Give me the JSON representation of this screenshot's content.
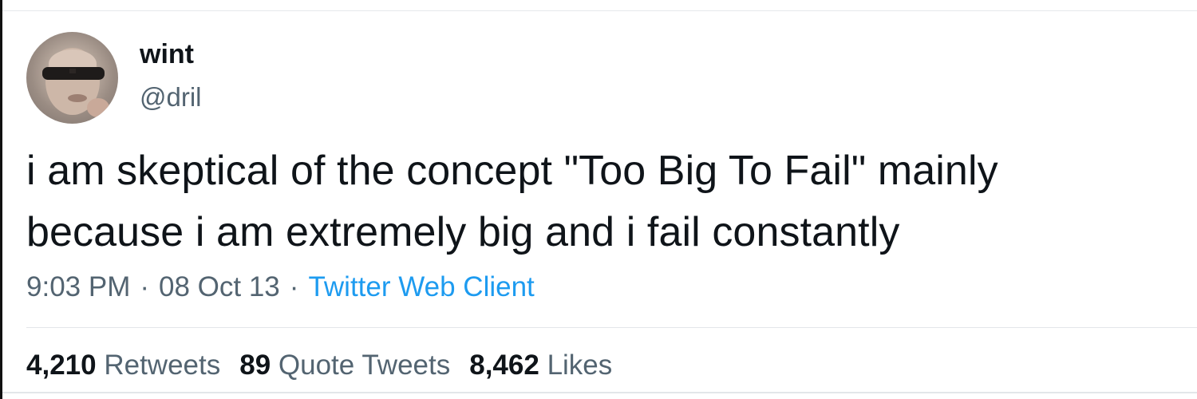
{
  "tweet": {
    "display_name": "wint",
    "handle": "@dril",
    "text_line_1": "i am skeptical of the concept \"Too Big To Fail\" mainly",
    "text_line_2": "because i am extremely big and i fail constantly",
    "time": "9:03 PM",
    "separator": "·",
    "date": "08 Oct 13",
    "source": "Twitter Web Client",
    "avatar_icon": "profile-photo-sunglasses",
    "colors": {
      "text": "#0f1419",
      "secondary": "#536471",
      "link": "#1d9bf0"
    }
  },
  "stats": {
    "retweets_count": "4,210",
    "retweets_label": "Retweets",
    "quotes_count": "89",
    "quotes_label": "Quote Tweets",
    "likes_count": "8,462",
    "likes_label": "Likes"
  }
}
